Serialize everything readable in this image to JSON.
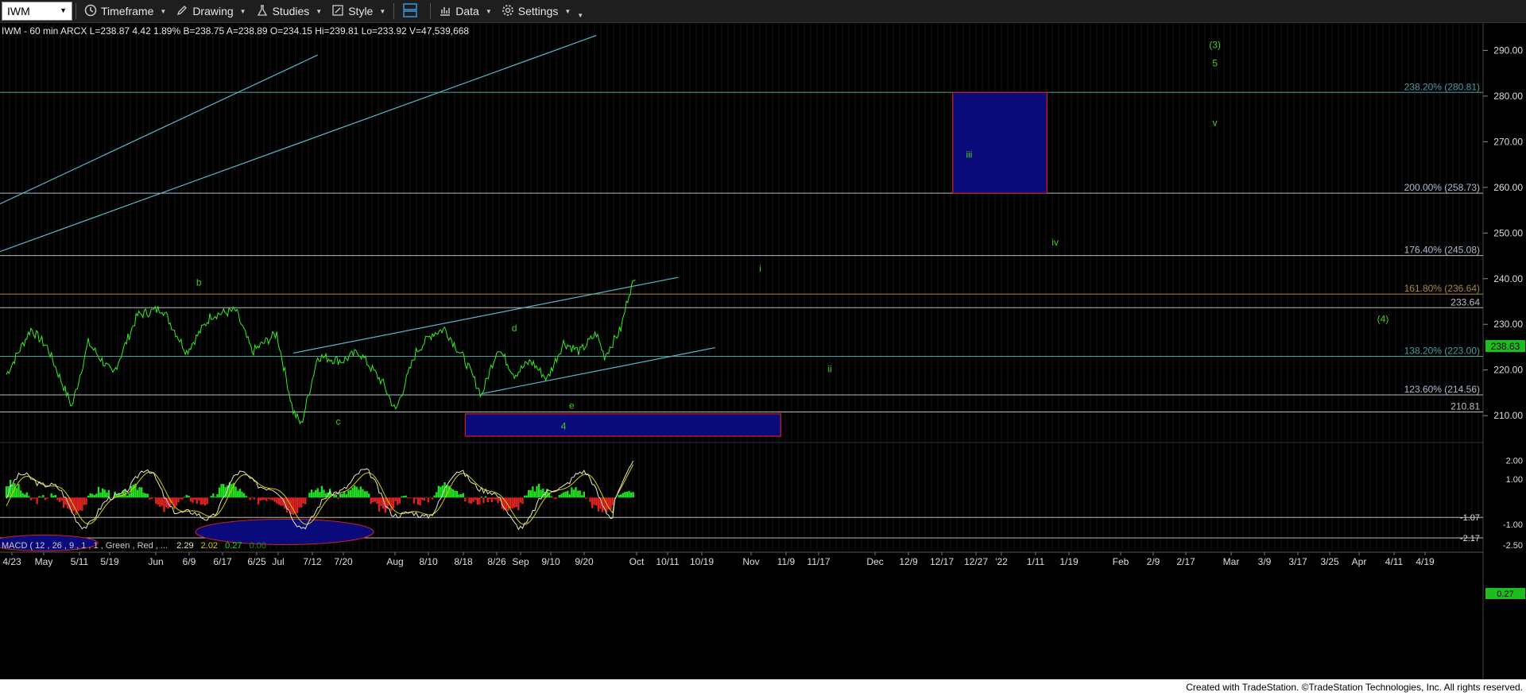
{
  "toolbar": {
    "symbol": "IWM",
    "items": [
      {
        "label": "Timeframe",
        "icon": "clock-icon"
      },
      {
        "label": "Drawing",
        "icon": "pencil-icon"
      },
      {
        "label": "Studies",
        "icon": "studies-icon"
      },
      {
        "label": "Style",
        "icon": "style-icon"
      },
      {
        "label": "",
        "icon": "layout-icon"
      },
      {
        "label": "Data",
        "icon": "bar-chart-icon"
      },
      {
        "label": "Settings",
        "icon": "gear-icon"
      }
    ]
  },
  "price_header": {
    "text": "IWM - 60 min  ARCX  L=238.87  4.42    1.89%    B=238.75  A=238.89  O=234.15  Hi=239.81  Lo=233.92  V=47,539,668"
  },
  "macd_header": {
    "prefix": "MACD ( 12 , 26 , 9 , 1 , 1 , Green , Red , ...",
    "v1": "2.29",
    "v2": "2.02",
    "v3": "0.27",
    "v4": "0.00"
  },
  "price_axis": {
    "labels": [
      "290.00",
      "280.00",
      "270.00",
      "260.00",
      "250.00",
      "240.00",
      "230.00",
      "220.00",
      "210.00"
    ],
    "last_price": "238.63"
  },
  "macd_axis": {
    "labels": [
      "2.00",
      "1.00",
      "-1.07",
      "-1.00",
      "-2.17",
      "-2.50"
    ],
    "last_value": "0.27"
  },
  "date_axis": {
    "labels": [
      "4/23",
      "May",
      "5/11",
      "5/19",
      "Jun",
      "6/9",
      "6/17",
      "6/25",
      "Jul",
      "7/12",
      "7/20",
      "Aug",
      "8/10",
      "8/18",
      "8/26",
      "Sep",
      "9/10",
      "9/20",
      "Oct",
      "10/11",
      "10/19",
      "Nov",
      "11/9",
      "11/17",
      "Dec",
      "12/9",
      "12/17",
      "12/27",
      "'22",
      "1/11",
      "1/19",
      "Feb",
      "2/9",
      "2/17",
      "Mar",
      "3/9",
      "3/17",
      "3/25",
      "Apr",
      "4/11",
      "4/19"
    ]
  },
  "fib_levels": [
    {
      "label": "238.20% (280.81)",
      "price": 280.81,
      "color": "#4a9a9a"
    },
    {
      "label": "200.00% (258.73)",
      "price": 258.73,
      "color": "#aabbcc"
    },
    {
      "label": "176.40% (245.08)",
      "price": 245.08,
      "color": "#aabbcc"
    },
    {
      "label": "161.80% (236.64)",
      "price": 236.64,
      "color": "#a08a3a"
    },
    {
      "label": "233.64",
      "price": 233.64,
      "color": "#bbbbbb"
    },
    {
      "label": "138.20% (223.00)",
      "price": 223.0,
      "color": "#4a9a9a"
    },
    {
      "label": "123.60% (214.56)",
      "price": 214.56,
      "color": "#aabbcc"
    },
    {
      "label": "210.81",
      "price": 210.81,
      "color": "#bbbbbb"
    }
  ],
  "wave_labels": [
    {
      "text": "(3)",
      "price": 290.5,
      "day": 295
    },
    {
      "text": "5",
      "price": 286.5,
      "day": 295
    },
    {
      "text": "v",
      "price": 273.5,
      "day": 295
    },
    {
      "text": "iii",
      "price": 266.5,
      "day": 235
    },
    {
      "text": "iv",
      "price": 247.3,
      "day": 256
    },
    {
      "text": "i",
      "price": 241.5,
      "day": 184
    },
    {
      "text": "b",
      "price": 238.5,
      "day": 47
    },
    {
      "text": "(4)",
      "price": 230.5,
      "day": 336
    },
    {
      "text": "d",
      "price": 228.5,
      "day": 124
    },
    {
      "text": "ii",
      "price": 219.5,
      "day": 201
    },
    {
      "text": "e",
      "price": 211.5,
      "day": 138
    },
    {
      "text": "c",
      "price": 208.0,
      "day": 81
    },
    {
      "text": "4",
      "price": 207.0,
      "day": 136
    }
  ],
  "colors": {
    "price_line": "#33ee22",
    "channel": "#5ab3c8",
    "box_fill": "#0a0a7a",
    "box_border": "#cc2222",
    "wave_label": "#44cc22",
    "macd_line1": "#e8e8c8",
    "macd_line2": "#d8d000",
    "hist_up": "#22dd22",
    "hist_down": "#dd2222"
  },
  "footer": {
    "text": "Created with TradeStation. ©TradeStation Technologies, Inc. All rights reserved."
  }
}
